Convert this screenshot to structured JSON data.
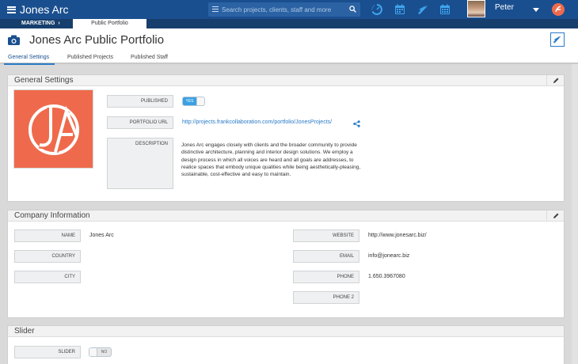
{
  "topbar": {
    "brand": "Jones Arc",
    "search_placeholder": "Search projects, clients, staff and more",
    "user_name": "Peter",
    "icons": [
      "menu-icon",
      "search-icon",
      "dashboard-gauge-icon",
      "calendar-icon",
      "send-icon",
      "calendar-icon",
      "frank-logo-icon"
    ]
  },
  "breadcrumb": {
    "section": "MARKETING",
    "separator": "›",
    "current": "Public Portfolio"
  },
  "header": {
    "title": "Jones Arc Public Portfolio",
    "tabs": [
      {
        "label": "General Settings",
        "active": true
      },
      {
        "label": "Published Projects",
        "active": false
      },
      {
        "label": "Published Staff",
        "active": false
      }
    ]
  },
  "general_settings": {
    "title": "General Settings",
    "published_label": "PUBLISHED",
    "published_toggle": "YES",
    "portfolio_url_label": "PORTFOLIO URL",
    "portfolio_url": "http://projects.frankcollaboration.com/portfolio/JonesProjects/",
    "description_label": "DESCRIPTION",
    "description": "Jones Arc engages closely with clients and the broader community to provide distinctive architecture, planning and interior design solutions. We employ a design process in which all voices are heard and all goals are addresses, to realice spaces that embody unique qualities while being aesthetically-pleasing, sustainable, cost-effective and easy to maintain."
  },
  "company_information": {
    "title": "Company Information",
    "name_label": "NAME",
    "name": "Jones Arc",
    "country_label": "COUNTRY",
    "city_label": "CITY",
    "website_label": "WEBSITE",
    "website": "http://www.jonesarc.biz/",
    "email_label": "EMAIL",
    "email": "info@jonearc.biz",
    "phone_label": "PHONE",
    "phone": "1.650.3967080",
    "phone2_label": "PHONE 2"
  },
  "slider": {
    "title": "Slider",
    "slider_label": "SLIDER",
    "slider_toggle": "NO"
  },
  "colors": {
    "nav_blue": "#1a4f8f",
    "accent_blue": "#2a7bc6",
    "logo_orange": "#ef6a4c"
  }
}
